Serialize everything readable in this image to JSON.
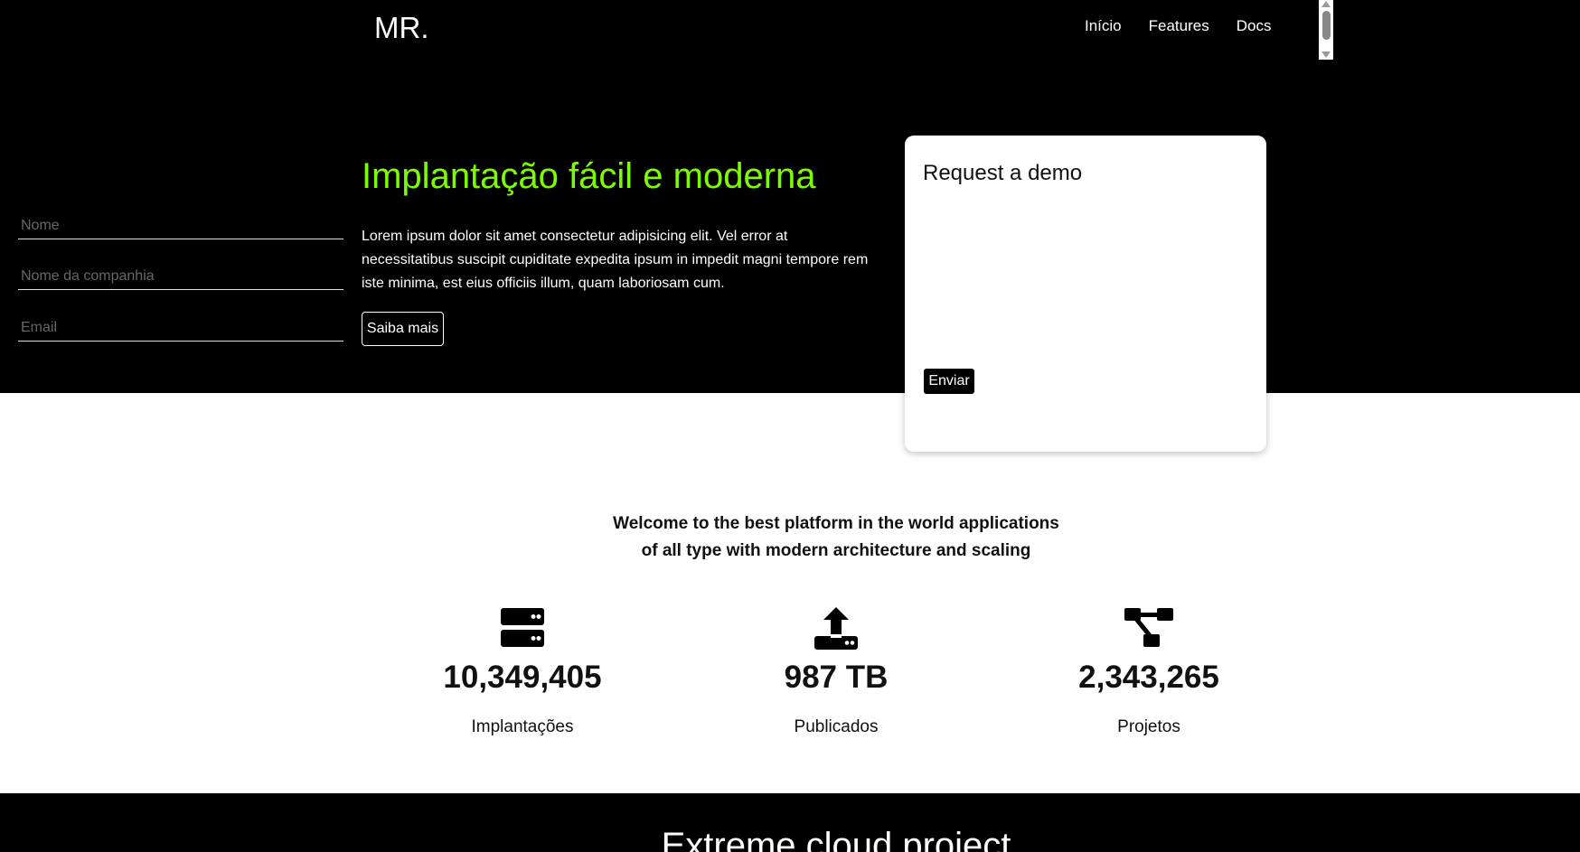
{
  "header": {
    "logo": "MR.",
    "nav": [
      "Início",
      "Features",
      "Docs"
    ]
  },
  "hero": {
    "title": "Implantação fácil e moderna",
    "text": "Lorem ipsum dolor sit amet consectetur adipisicing elit. Vel error at necessitatibus suscipit cupiditate expedita ipsum in impedit magni tempore rem iste minima, est eius officiis illum, quam laboriosam cum.",
    "button_label": "Saiba mais"
  },
  "demo_form": {
    "title": "Request a demo",
    "fields": [
      {
        "placeholder": "Nome",
        "value": ""
      },
      {
        "placeholder": "Nome da companhia",
        "value": ""
      },
      {
        "placeholder": "Email",
        "value": ""
      }
    ],
    "submit_label": "Enviar"
  },
  "welcome": {
    "line1": "Welcome to the best platform in the world applications",
    "line2": "of all type with modern architecture and scaling"
  },
  "stats": [
    {
      "icon": "server-icon",
      "value": "10,349,405",
      "label": "Implantações"
    },
    {
      "icon": "upload-icon",
      "value": "987 TB",
      "label": "Publicados"
    },
    {
      "icon": "project-diagram-icon",
      "value": "2,343,265",
      "label": "Projetos"
    }
  ],
  "footer": {
    "title": "Extreme cloud project"
  },
  "colors": {
    "accent": "#7cfc00",
    "background_dark": "#000000"
  }
}
